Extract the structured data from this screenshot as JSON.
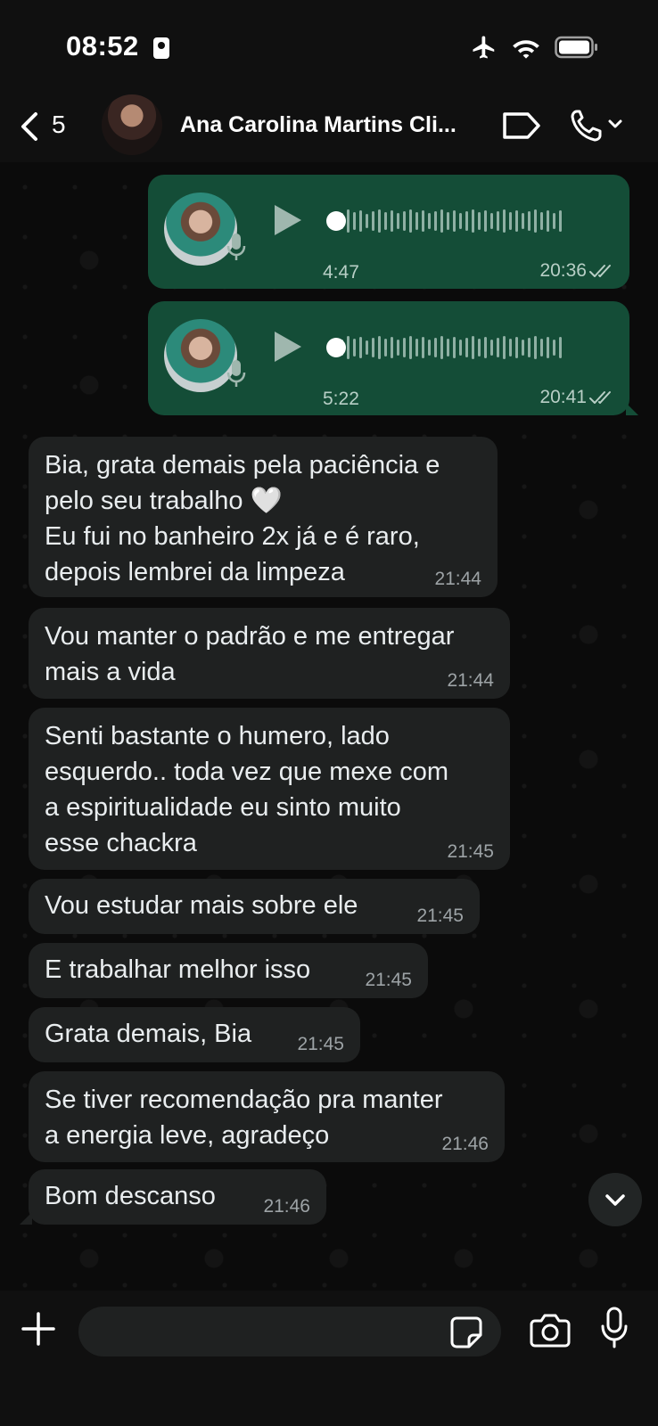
{
  "status_bar": {
    "time": "08:52"
  },
  "header": {
    "back_count": "5",
    "contact_name": "Ana Carolina Martins Cli..."
  },
  "voice_messages": [
    {
      "duration": "4:47",
      "time": "20:36"
    },
    {
      "duration": "5:22",
      "time": "20:41"
    }
  ],
  "messages": [
    {
      "text": "Bia, grata demais pela paciência e\npelo seu trabalho 🤍\nEu fui no banheiro 2x já e é raro,\ndepois lembrei da limpeza",
      "time": "21:44"
    },
    {
      "text": "Vou manter o padrão e me entregar\nmais a vida",
      "time": "21:44"
    },
    {
      "text": "Senti bastante o humero, lado\nesquerdo.. toda vez que mexe com\na espiritualidade eu sinto muito\nesse chackra",
      "time": "21:45"
    },
    {
      "text": "Vou estudar mais sobre ele",
      "time": "21:45"
    },
    {
      "text": "E trabalhar melhor isso",
      "time": "21:45"
    },
    {
      "text": "Grata demais, Bia",
      "time": "21:45"
    },
    {
      "text": "Se tiver recomendação pra manter\na energia leve, agradeço",
      "time": "21:46"
    },
    {
      "text": "Bom descanso",
      "time": "21:46"
    }
  ],
  "colors": {
    "outgoing_bubble": "#144d37",
    "incoming_bubble": "#1f2121",
    "background": "#0b0b0b"
  },
  "icons": [
    "airplane-icon",
    "wifi-icon",
    "battery-icon",
    "back-chevron-icon",
    "label-tag-icon",
    "phone-icon",
    "chevron-down-icon",
    "plus-icon",
    "sticker-icon",
    "camera-icon",
    "microphone-icon"
  ]
}
